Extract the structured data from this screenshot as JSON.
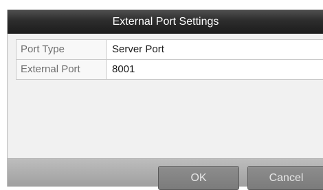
{
  "dialog": {
    "title": "External Port Settings",
    "fields": [
      {
        "label": "Port Type",
        "value": "Server Port"
      },
      {
        "label": "External Port",
        "value": "8001"
      }
    ],
    "buttons": {
      "ok": "OK",
      "cancel": "Cancel"
    }
  }
}
